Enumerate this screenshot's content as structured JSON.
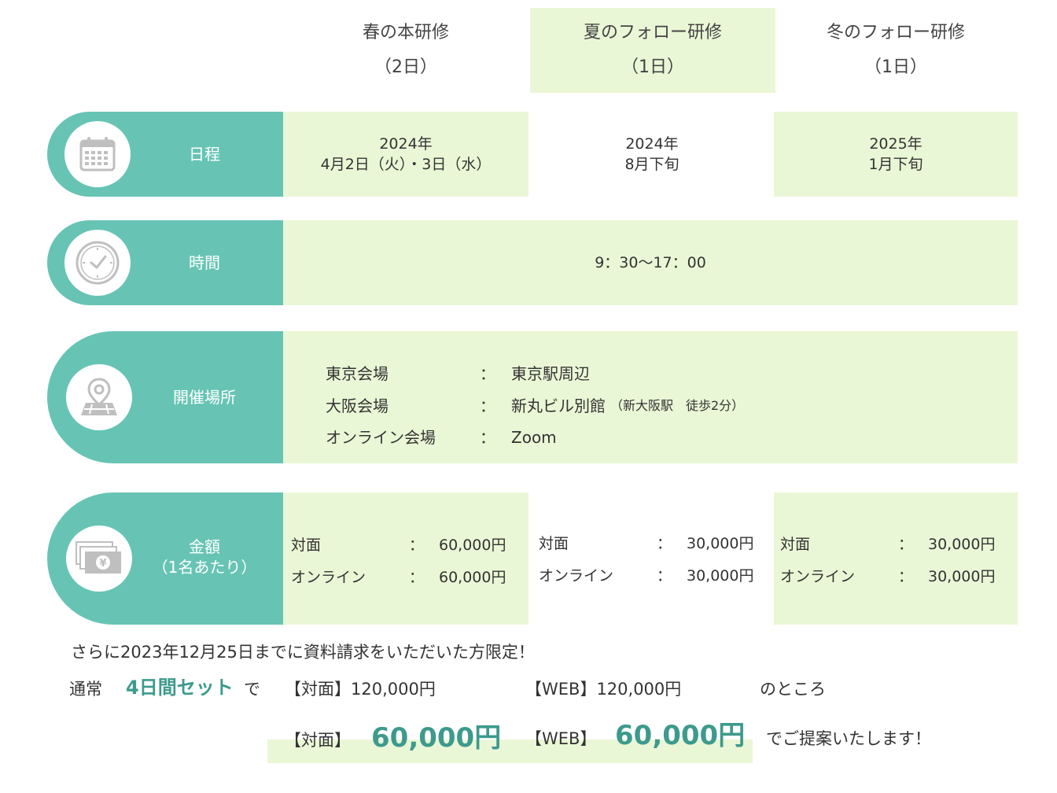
{
  "columns": [
    {
      "name": "春の本研修",
      "days": "（2日）"
    },
    {
      "name": "夏のフォロー研修",
      "days": "（1日）"
    },
    {
      "name": "冬のフォロー研修",
      "days": "（1日）"
    }
  ],
  "schedule": {
    "label": "日程",
    "icon": "calendar-icon",
    "spring": {
      "year": "2024年",
      "date": "4月2日（火）・3日（水）"
    },
    "summer": {
      "year": "2024年",
      "date": "8月下旬"
    },
    "winter": {
      "year": "2025年",
      "date": "1月下旬"
    }
  },
  "time": {
    "label": "時間",
    "icon": "clock-icon",
    "value": "9：30〜17：00"
  },
  "venue": {
    "label": "開催場所",
    "icon": "map-pin-icon",
    "rows": [
      {
        "name": "東京会場",
        "sep": "：",
        "place": "東京駅周辺",
        "note": ""
      },
      {
        "name": "大阪会場",
        "sep": "：",
        "place": "新丸ビル別館",
        "note": "（新大阪駅　徒歩2分）"
      },
      {
        "name": "オンライン会場",
        "sep": "：",
        "place": "Zoom",
        "note": ""
      }
    ]
  },
  "fee": {
    "label_line1": "金額",
    "label_line2": "（1名あたり）",
    "icon": "money-icon",
    "spring": [
      {
        "type": "対面",
        "sep": "：",
        "price": "60,000円"
      },
      {
        "type": "オンライン",
        "sep": "：",
        "price": "60,000円"
      }
    ],
    "summer": [
      {
        "type": "対面",
        "sep": "：",
        "price": "30,000円"
      },
      {
        "type": "オンライン",
        "sep": "：",
        "price": "30,000円"
      }
    ],
    "winter": [
      {
        "type": "対面",
        "sep": "：",
        "price": "30,000円"
      },
      {
        "type": "オンライン",
        "sep": "：",
        "price": "30,000円"
      }
    ]
  },
  "promo": {
    "line1": "さらに2023年12月25日までに資料請求をいただいた方限定！",
    "normal": "通常",
    "set": "4日間セット",
    "de": "で",
    "normal_inperson": "【対面】120,000円",
    "normal_web": "【WEB】120,000円",
    "tokoro": "のところ",
    "offer_inperson_label": "【対面】",
    "offer_inperson_price": "60,000円",
    "offer_web_label": "【WEB】",
    "offer_web_price": "60,000円",
    "closing": "でご提案いたします！"
  },
  "colors": {
    "teal": "#67c4b4",
    "light_green": "#eaf7d6",
    "accent": "#3d9a8d"
  }
}
